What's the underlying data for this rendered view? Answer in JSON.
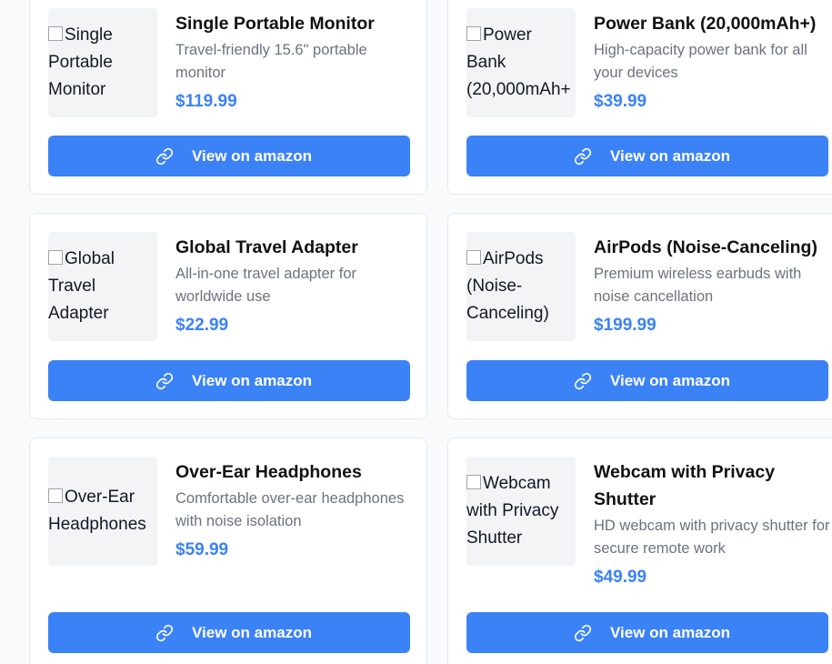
{
  "products": [
    {
      "name": "Single Portable Monitor",
      "image_alt": "Single Portable Monitor",
      "description": "Travel-friendly 15.6\" portable monitor",
      "price": "$119.99",
      "button_label": "View on amazon"
    },
    {
      "name": "Power Bank (20,000mAh+)",
      "image_alt": "Power Bank (20,000mAh+",
      "description": "High-capacity power bank for all your devices",
      "price": "$39.99",
      "button_label": "View on amazon"
    },
    {
      "name": "Global Travel Adapter",
      "image_alt": "Global Travel Adapter",
      "description": "All-in-one travel adapter for worldwide use",
      "price": "$22.99",
      "button_label": "View on amazon"
    },
    {
      "name": "AirPods (Noise-Canceling)",
      "image_alt": "AirPods (Noise-Canceling)",
      "description": "Premium wireless earbuds with noise cancellation",
      "price": "$199.99",
      "button_label": "View on amazon"
    },
    {
      "name": "Over-Ear Headphones",
      "image_alt": "Over-Ear Headphones",
      "description": "Comfortable over-ear headphones with noise isolation",
      "price": "$59.99",
      "button_label": "View on amazon"
    },
    {
      "name": "Webcam with Privacy Shutter",
      "image_alt": "Webcam with Privacy Shutter",
      "description": "HD webcam with privacy shutter for secure remote work",
      "price": "$49.99",
      "button_label": "View on amazon"
    }
  ],
  "colors": {
    "accent": "#3b82f6",
    "card_border": "#e5e7eb",
    "thumb_bg": "#f3f4f6",
    "muted_text": "#6b7280"
  },
  "icons": {
    "button": "link-icon",
    "thumbnail": "broken-image-icon"
  }
}
